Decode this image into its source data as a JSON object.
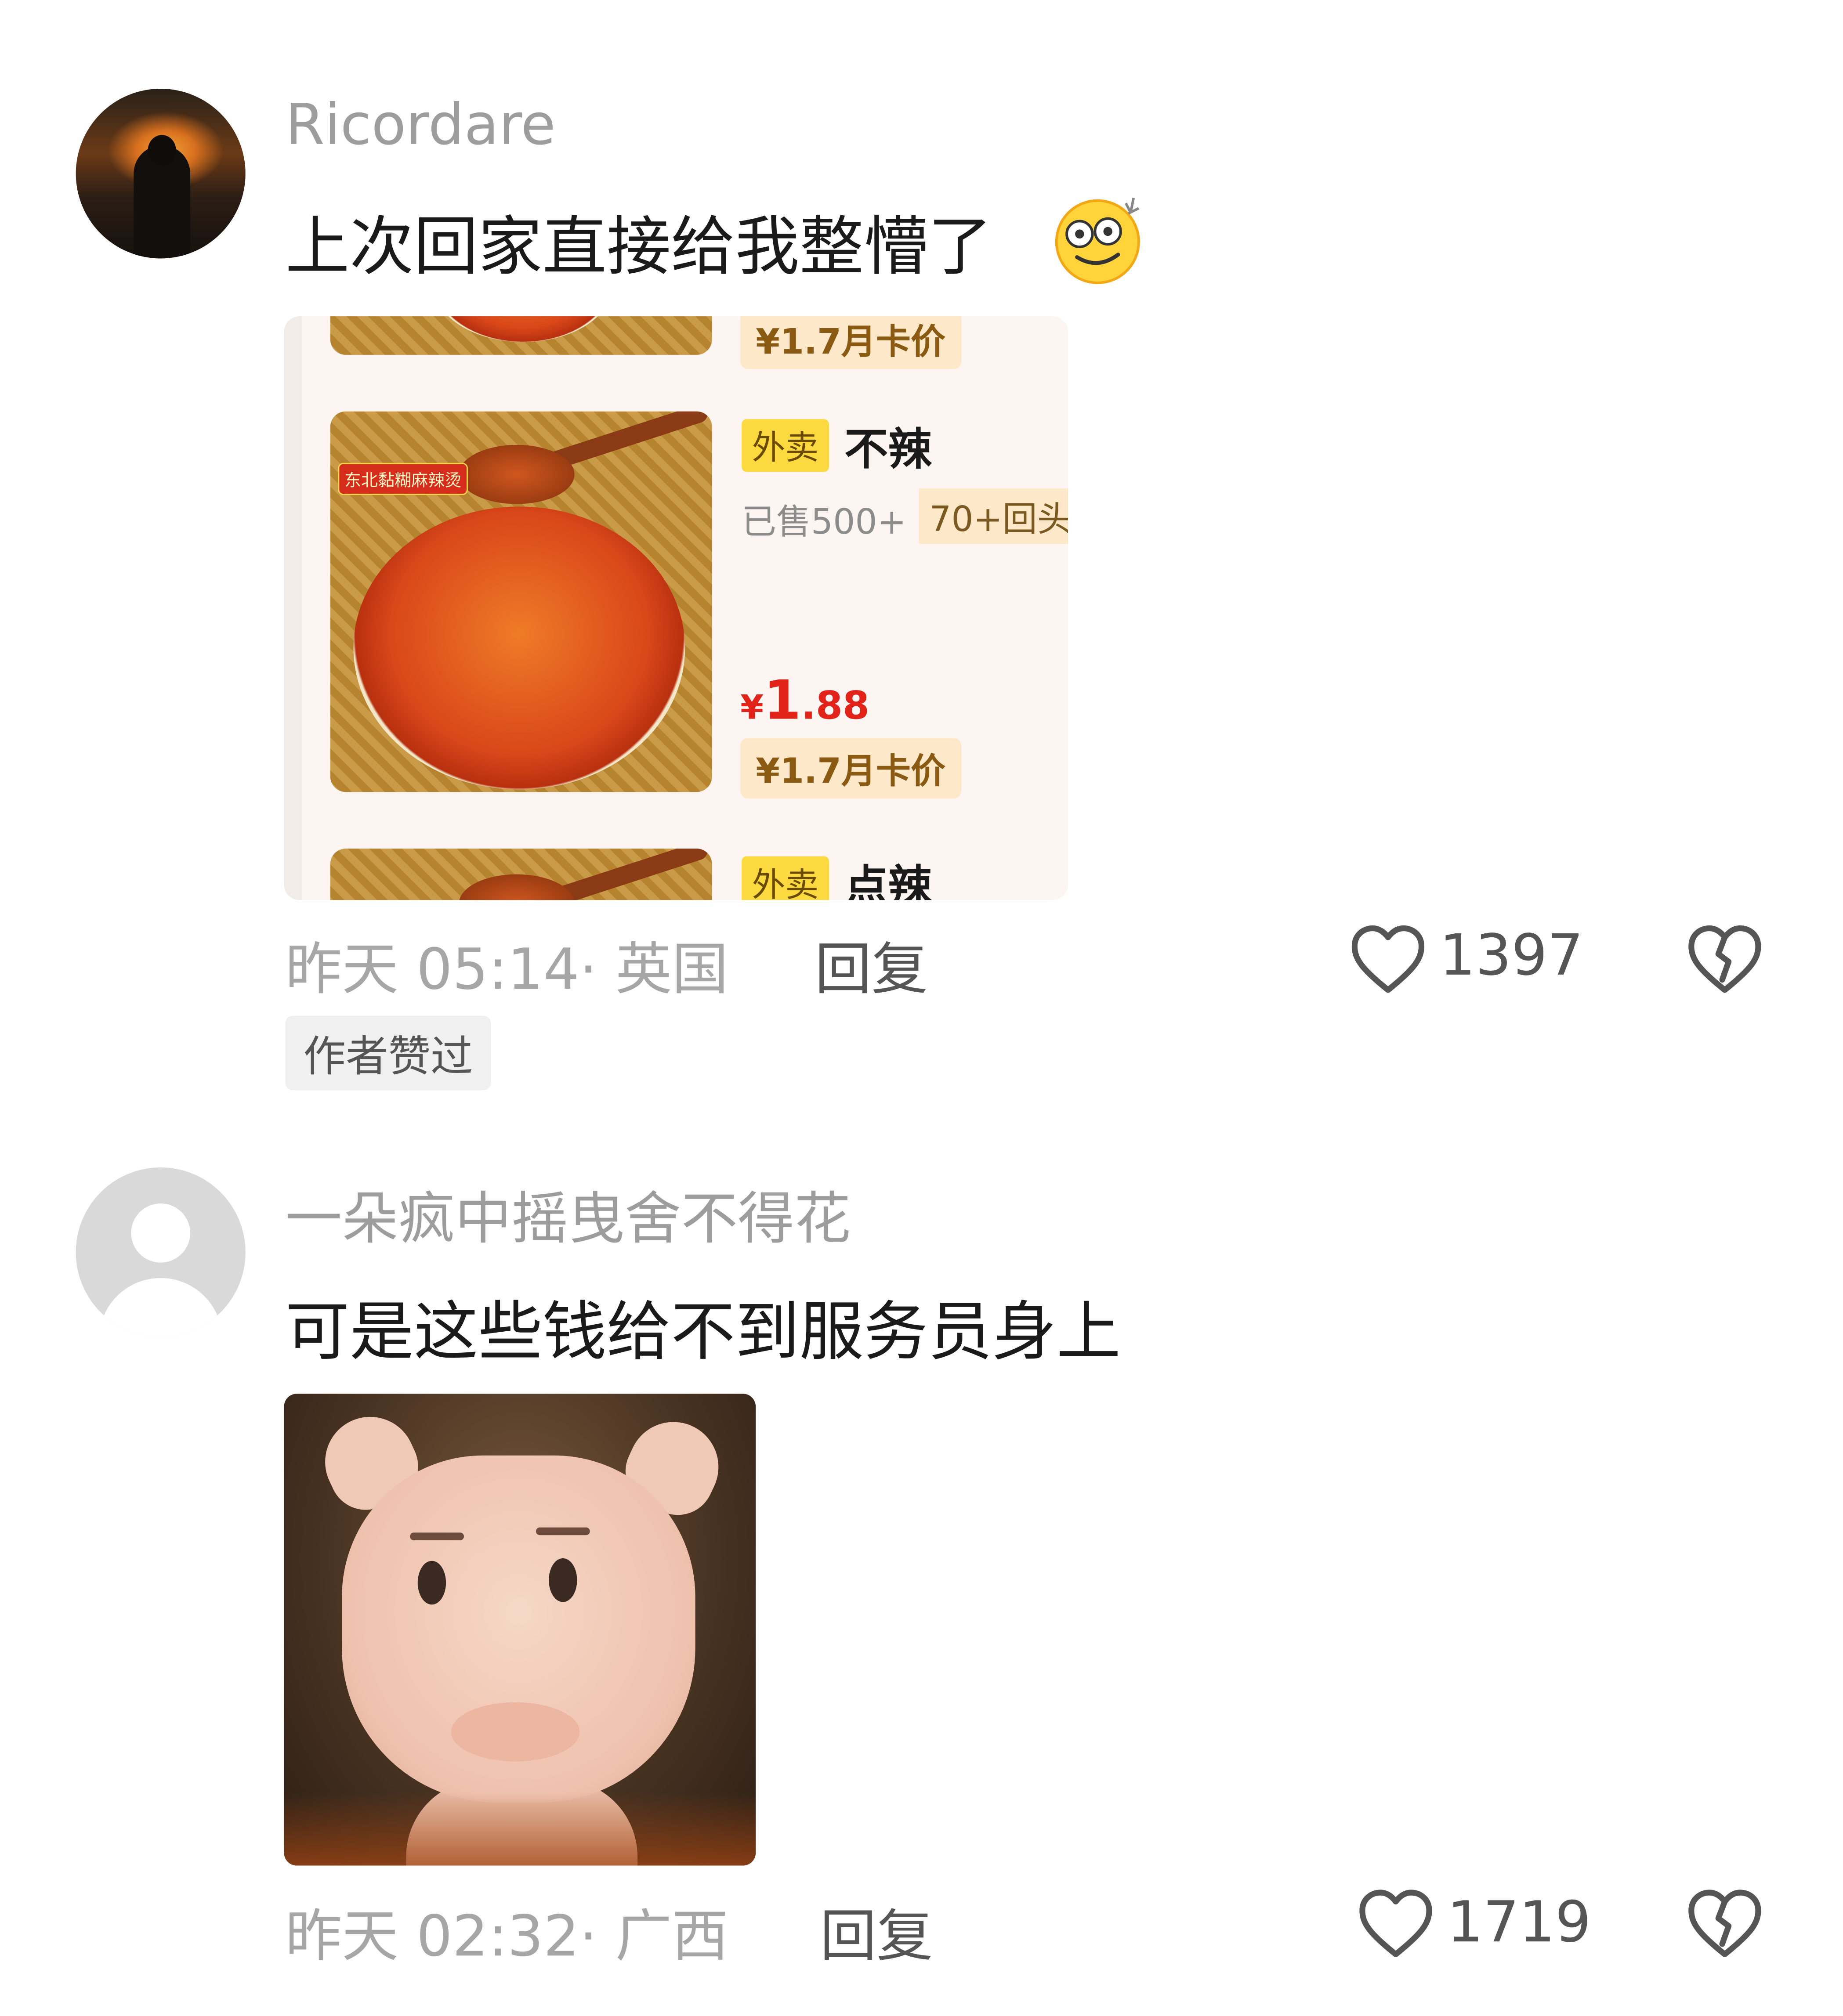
{
  "comments": [
    {
      "username": "Ricordare",
      "text": "上次回家直接给我整懵了",
      "emoji": "dizzy-face-emoji",
      "embed": {
        "top_partial_price": "¥1.7月卡价",
        "item": {
          "badge": "外卖",
          "title": "不辣",
          "sold": "已售500+",
          "repeat": "70+回头",
          "price_currency": "¥",
          "price_int": "1",
          "price_dec": ".88",
          "card_price": "¥1.7月卡价",
          "food_label": "东北黏糊麻辣烫"
        },
        "next_item": {
          "badge": "外卖",
          "title": "点辣"
        }
      },
      "timestamp": "昨天 05:14",
      "location": "· 英国",
      "reply_label": "回复",
      "likes": "1397",
      "author_liked": "作者赞过"
    },
    {
      "username": "一朵疯中摇曳舍不得花",
      "text": "可是这些钱给不到服务员身上",
      "sticker": "pig-face-sticker",
      "timestamp": "昨天 02:32",
      "location": "· 广西",
      "reply_label": "回复",
      "likes": "1719"
    }
  ],
  "icons": {
    "like": "heart-outline-icon",
    "dislike": "broken-heart-icon"
  },
  "colors": {
    "price_red": "#e2231a",
    "badge_yellow": "#fbd93f",
    "meta_gray": "#a6a6a6"
  }
}
